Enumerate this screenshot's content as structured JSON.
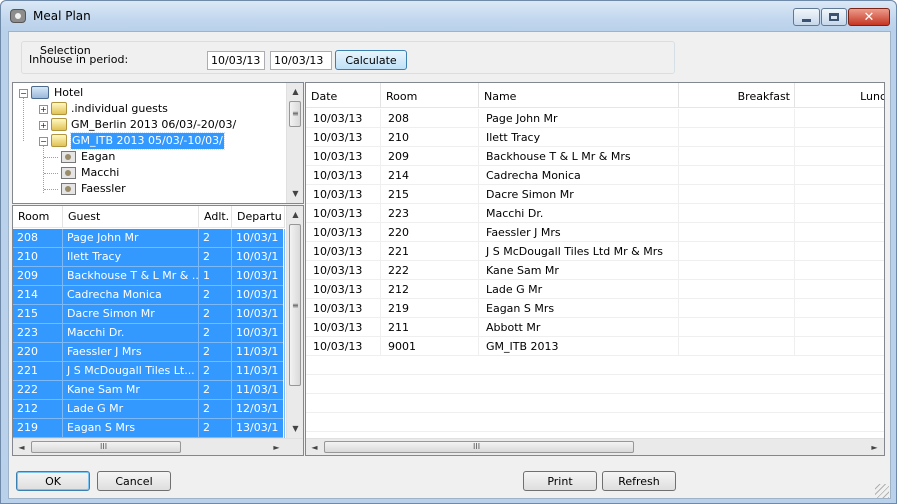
{
  "window": {
    "title": "Meal Plan",
    "close_glyph": "✕"
  },
  "selection": {
    "caption": "Selection",
    "period_label": "Inhouse in period:",
    "date_from": "10/03/13",
    "date_to": "10/03/13",
    "calculate_label": "Calculate"
  },
  "tree": {
    "root": "Hotel",
    "items": [
      ".individual guests",
      "GM_Berlin 2013 06/03/-20/03/",
      "GM_ITB 2013 05/03/-10/03/"
    ],
    "children": [
      "Eagan",
      "Macchi",
      "Faessler"
    ],
    "expand_glyph": "+",
    "collapse_glyph": "−"
  },
  "guest_grid": {
    "columns": [
      "Room",
      "Guest",
      "Adlt.",
      "Departu"
    ],
    "rows": [
      [
        "208",
        "Page John Mr",
        "2",
        "10/03/1"
      ],
      [
        "210",
        "Ilett Tracy",
        "2",
        "10/03/1"
      ],
      [
        "209",
        "Backhouse T & L Mr & ...",
        "1",
        "10/03/1"
      ],
      [
        "214",
        "Cadrecha Monica",
        "2",
        "10/03/1"
      ],
      [
        "215",
        "Dacre Simon Mr",
        "2",
        "10/03/1"
      ],
      [
        "223",
        "Macchi  Dr.",
        "2",
        "10/03/1"
      ],
      [
        "220",
        "Faessler J Mrs",
        "2",
        "11/03/1"
      ],
      [
        "221",
        "J S McDougall Tiles Lt...",
        "2",
        "11/03/1"
      ],
      [
        "222",
        "Kane Sam Mr",
        "2",
        "11/03/1"
      ],
      [
        "212",
        "Lade G Mr",
        "2",
        "12/03/1"
      ],
      [
        "219",
        "Eagan S Mrs",
        "2",
        "13/03/1"
      ]
    ]
  },
  "meal_grid": {
    "columns": [
      "Date",
      "Room",
      "Name",
      "Breakfast",
      "Lunc"
    ],
    "rows": [
      [
        "10/03/13",
        "208",
        "Page John Mr"
      ],
      [
        "10/03/13",
        "210",
        "Ilett Tracy"
      ],
      [
        "10/03/13",
        "209",
        "Backhouse T & L Mr & Mrs"
      ],
      [
        "10/03/13",
        "214",
        "Cadrecha Monica"
      ],
      [
        "10/03/13",
        "215",
        "Dacre Simon Mr"
      ],
      [
        "10/03/13",
        "223",
        "Macchi  Dr."
      ],
      [
        "10/03/13",
        "220",
        "Faessler J Mrs"
      ],
      [
        "10/03/13",
        "221",
        "J S McDougall Tiles Ltd  Mr & Mrs"
      ],
      [
        "10/03/13",
        "222",
        "Kane Sam Mr"
      ],
      [
        "10/03/13",
        "212",
        "Lade G Mr"
      ],
      [
        "10/03/13",
        "219",
        "Eagan S Mrs"
      ],
      [
        "10/03/13",
        "211",
        "Abbott  Mr"
      ],
      [
        "10/03/13",
        "9001",
        "GM_ITB 2013"
      ]
    ]
  },
  "buttons": {
    "ok": "OK",
    "cancel": "Cancel",
    "print": "Print",
    "refresh": "Refresh"
  },
  "scroll_glyphs": {
    "up": "▲",
    "down": "▼",
    "left": "◄",
    "right": "►",
    "grip_v": "≡",
    "grip_h": "III"
  },
  "colors": {
    "selection": "#3399ff",
    "window_frame": "#b9d1ea",
    "close_button": "#c53522"
  }
}
